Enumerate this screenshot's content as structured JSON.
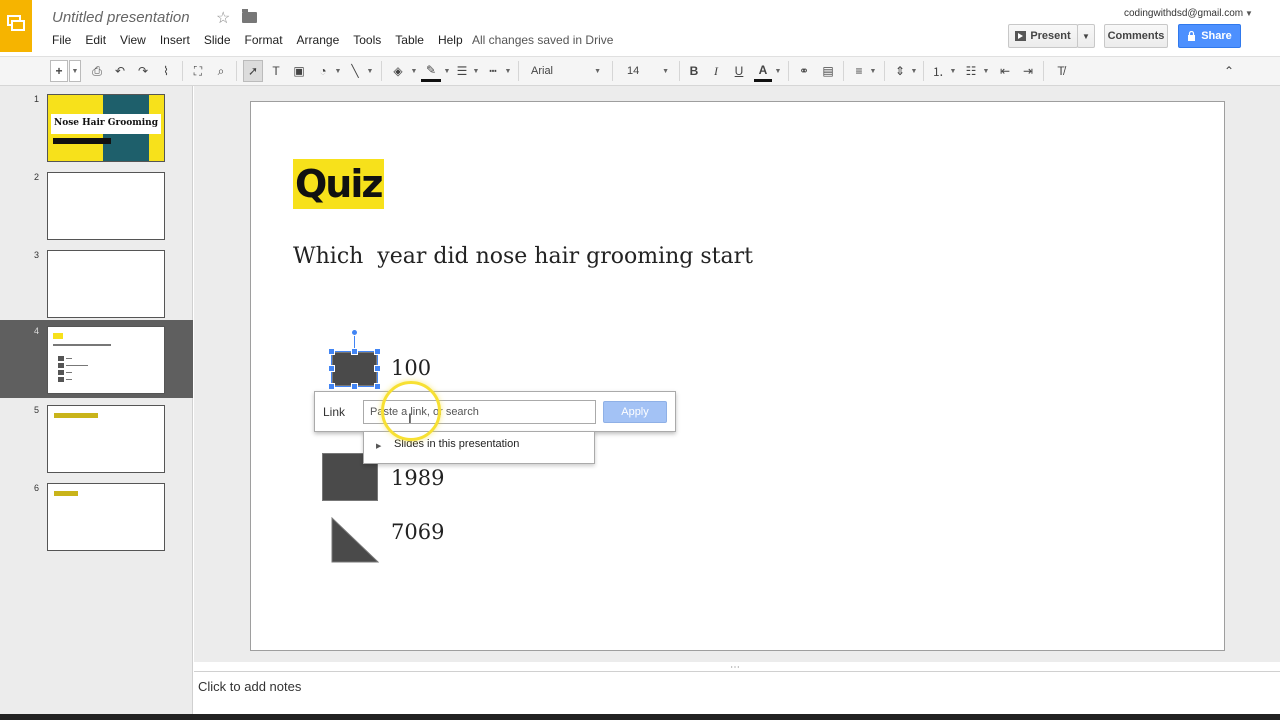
{
  "header": {
    "doc_title": "Untitled presentation",
    "menu": [
      "File",
      "Edit",
      "View",
      "Insert",
      "Slide",
      "Format",
      "Arrange",
      "Tools",
      "Table",
      "Help"
    ],
    "save_status": "All changes saved in Drive",
    "user_email": "codingwithdsd@gmail.com",
    "present_label": "Present",
    "comments_label": "Comments",
    "share_label": "Share"
  },
  "toolbar": {
    "font_name": "Arial",
    "font_size": "14",
    "bold_label": "B",
    "italic_label": "I",
    "underline_label": "U",
    "text_color_label": "A"
  },
  "filmstrip": {
    "slides": [
      {
        "number": "1",
        "title": "Nose Hair Grooming"
      },
      {
        "number": "2"
      },
      {
        "number": "3"
      },
      {
        "number": "4"
      },
      {
        "number": "5"
      },
      {
        "number": "6"
      }
    ]
  },
  "slide": {
    "title": "Quiz",
    "question": "Which  year did nose hair grooming start",
    "answers": [
      "100",
      "1989",
      "7069"
    ]
  },
  "link_popup": {
    "label": "Link",
    "placeholder": "Paste a link, or search",
    "apply_label": "Apply",
    "dropdown_item": "Slides in this presentation"
  },
  "notes": {
    "placeholder": "Click to add notes"
  },
  "colors": {
    "accent_yellow": "#f7e11b",
    "share_blue": "#4d90fe",
    "selection_blue": "#4285f4"
  }
}
